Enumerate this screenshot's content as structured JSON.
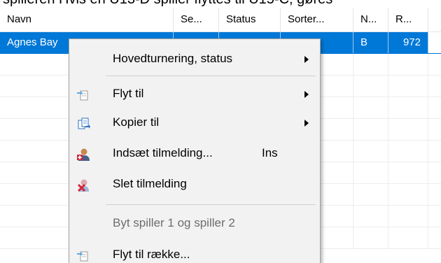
{
  "top_text": "spilleren Hvis en U13-D spiller flyttes til U15-C, gøres",
  "columns": [
    "Navn",
    "Se...",
    "Status",
    "Sorter...",
    "N...",
    "R..."
  ],
  "selected_row": {
    "name": "Agnes Bay",
    "n": "B",
    "r": "972"
  },
  "context_menu": {
    "items": [
      {
        "label": "Hovedturnering, status",
        "icon": "",
        "submenu": true
      },
      {
        "label": "Flyt til",
        "icon": "move-document-icon",
        "submenu": true
      },
      {
        "label": "Kopier til",
        "icon": "copy-documents-icon",
        "submenu": true
      },
      {
        "label": "Indsæt tilmelding...",
        "shortcut": "Ins",
        "icon": "add-user-icon",
        "submenu": false
      },
      {
        "label": "Slet tilmelding",
        "icon": "delete-user-icon",
        "submenu": false
      },
      {
        "label": "Byt spiller 1 og spiller 2",
        "icon": "",
        "disabled": true
      },
      {
        "label": "Flyt til række...",
        "icon": "move-document-icon",
        "submenu": false
      }
    ]
  },
  "colors": {
    "selection": "#0078d7",
    "menu_bg": "#f2f2f2"
  }
}
